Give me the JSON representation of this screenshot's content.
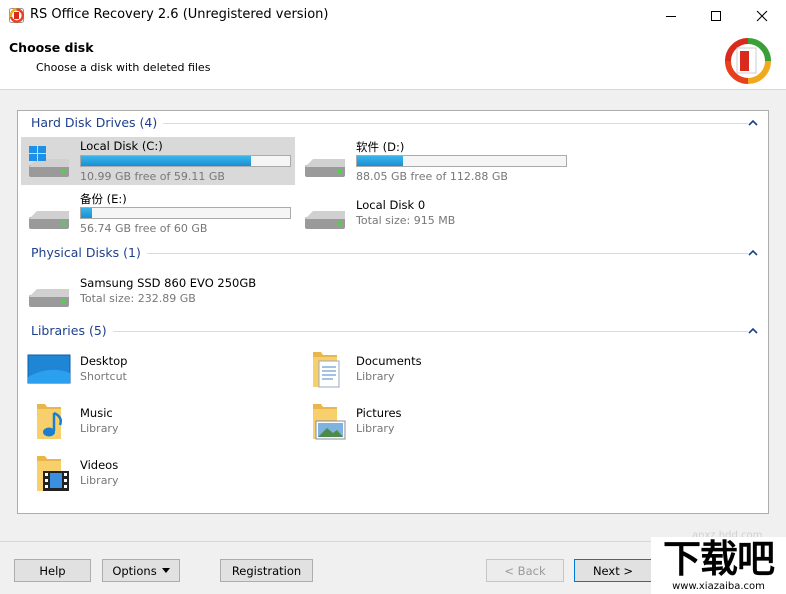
{
  "window": {
    "title": "RS Office Recovery 2.6 (Unregistered version)"
  },
  "header": {
    "title": "Choose disk",
    "subtitle": "Choose a disk with deleted files"
  },
  "groups": {
    "hdd": {
      "title": "Hard Disk Drives (4)",
      "items": [
        {
          "name": "Local Disk (C:)",
          "sub": "10.99 GB free of 59.11 GB",
          "used_fraction": 0.814,
          "icon": "windows-drive-icon"
        },
        {
          "name": "软件 (D:)",
          "sub": "88.05 GB free of 112.88 GB",
          "used_fraction": 0.22,
          "icon": "drive-icon"
        },
        {
          "name": "备份 (E:)",
          "sub": "56.74 GB free of 60 GB",
          "used_fraction": 0.055,
          "icon": "drive-icon"
        },
        {
          "name": "Local Disk 0",
          "sub": "Total size: 915 MB",
          "icon": "drive-icon"
        }
      ]
    },
    "physical": {
      "title": "Physical Disks (1)",
      "items": [
        {
          "name": "Samsung SSD 860 EVO 250GB",
          "sub": "Total size: 232.89 GB",
          "icon": "drive-icon"
        }
      ]
    },
    "libraries": {
      "title": "Libraries (5)",
      "items": [
        {
          "name": "Desktop",
          "sub": "Shortcut",
          "icon": "desktop-icon"
        },
        {
          "name": "Documents",
          "sub": "Library",
          "icon": "documents-folder-icon"
        },
        {
          "name": "Music",
          "sub": "Library",
          "icon": "music-folder-icon"
        },
        {
          "name": "Pictures",
          "sub": "Library",
          "icon": "pictures-folder-icon"
        },
        {
          "name": "Videos",
          "sub": "Library",
          "icon": "videos-folder-icon"
        }
      ]
    }
  },
  "buttons": {
    "help": "Help",
    "options": "Options",
    "registration": "Registration",
    "back": "< Back",
    "next": "Next >"
  },
  "watermark": {
    "main": "下载吧",
    "url": "www.xiazaiba.com",
    "faint": "anxz.hdd.com"
  },
  "colors": {
    "group_title": "#1e3f8c",
    "bar_fill": "#1a8fd6",
    "selected_bg": "#d9d9d9",
    "focus_border": "#0078d7"
  }
}
